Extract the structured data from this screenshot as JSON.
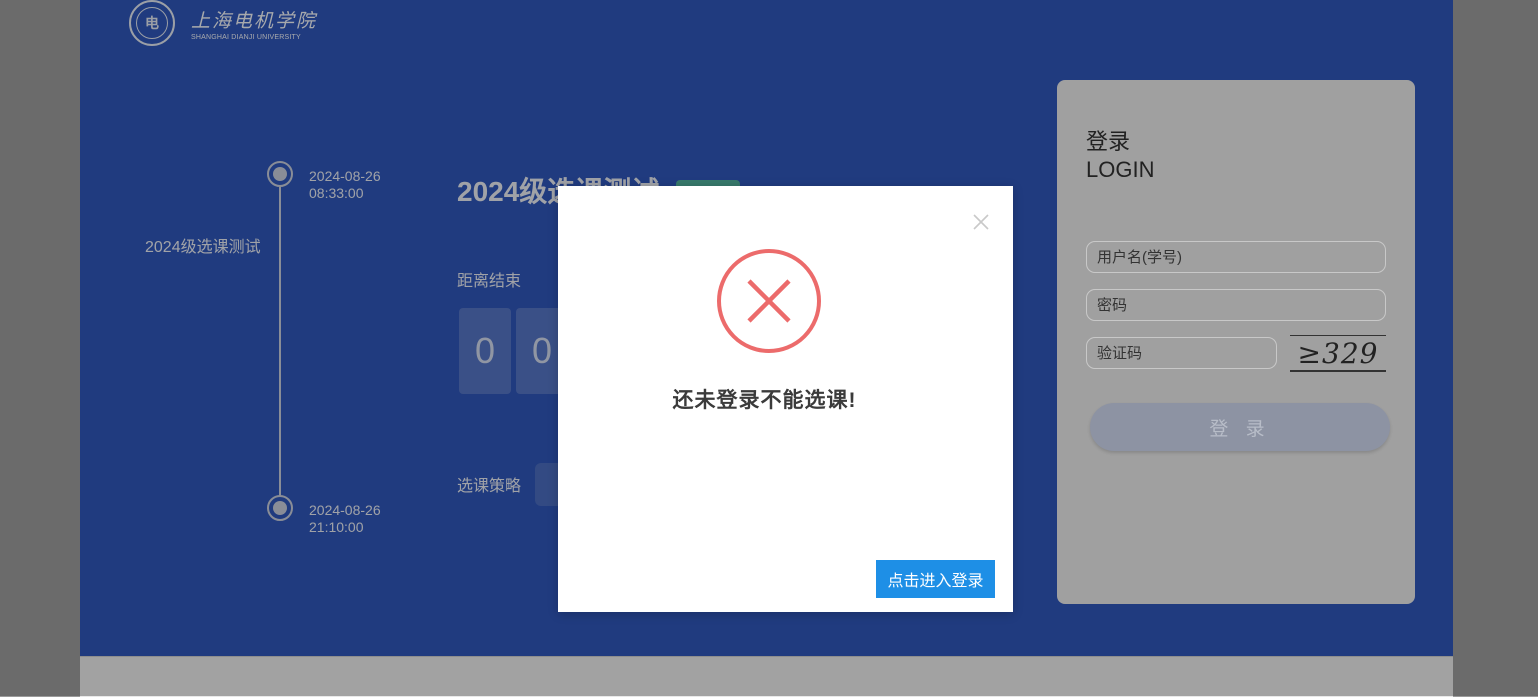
{
  "header": {
    "logo_cn": "上海电机学院",
    "logo_en": "SHANGHAI DIANJI UNIVERSITY",
    "seal_text": "电"
  },
  "timeline": {
    "name": "2024级选课测试",
    "start_date": "2024-08-26",
    "start_time": "08:33:00",
    "end_date": "2024-08-26",
    "end_time": "21:10:00"
  },
  "main": {
    "course_title": "2024级选课测试",
    "countdown_label": "距离结束",
    "digits": [
      "0",
      "0"
    ],
    "strategy_label": "选课策略"
  },
  "login": {
    "title_cn": "登录",
    "title_en": "LOGIN",
    "username_placeholder": "用户名(学号)",
    "password_placeholder": "密码",
    "captcha_placeholder": "验证码",
    "captcha_text": "≥329",
    "button_label": "登 录"
  },
  "dialog": {
    "message": "还未登录不能选课!",
    "button_label": "点击进入登录",
    "close_symbol": "×"
  },
  "colors": {
    "page_blue": "#2e55b6",
    "error_red": "#ec6b6b",
    "button_blue": "#1e8fe6"
  }
}
